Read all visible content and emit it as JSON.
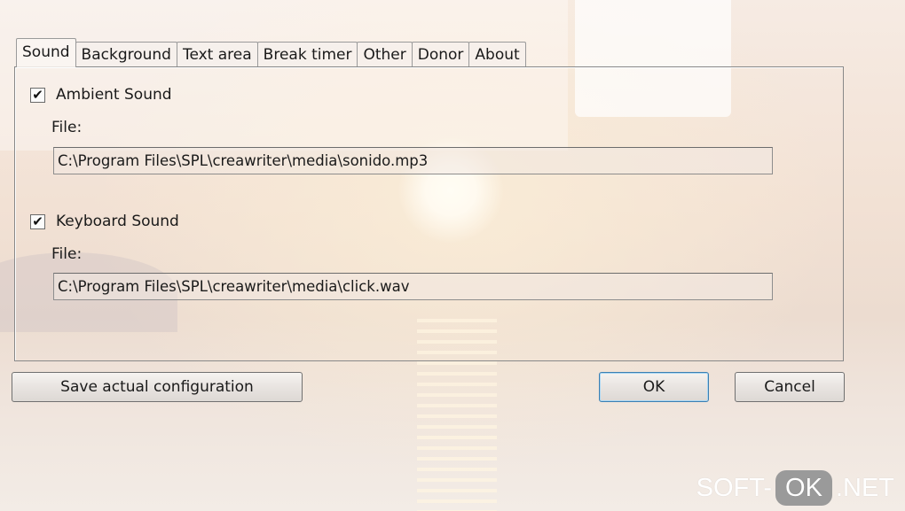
{
  "tabs": [
    {
      "label": "Sound",
      "active": true
    },
    {
      "label": "Background"
    },
    {
      "label": "Text area"
    },
    {
      "label": "Break timer"
    },
    {
      "label": "Other"
    },
    {
      "label": "Donor"
    },
    {
      "label": "About"
    }
  ],
  "ambient": {
    "label": "Ambient Sound",
    "checked": true,
    "file_label": "File:",
    "file_value": "C:\\Program Files\\SPL\\creawriter\\media\\sonido.mp3"
  },
  "keyboard": {
    "label": "Keyboard Sound",
    "checked": true,
    "file_label": "File:",
    "file_value": "C:\\Program Files\\SPL\\creawriter\\media\\click.wav"
  },
  "buttons": {
    "save": "Save actual configuration",
    "ok": "OK",
    "cancel": "Cancel"
  },
  "checkmark": "✔",
  "watermark": {
    "left": "SOFT-",
    "mid": "OK",
    "right": ".NET"
  }
}
